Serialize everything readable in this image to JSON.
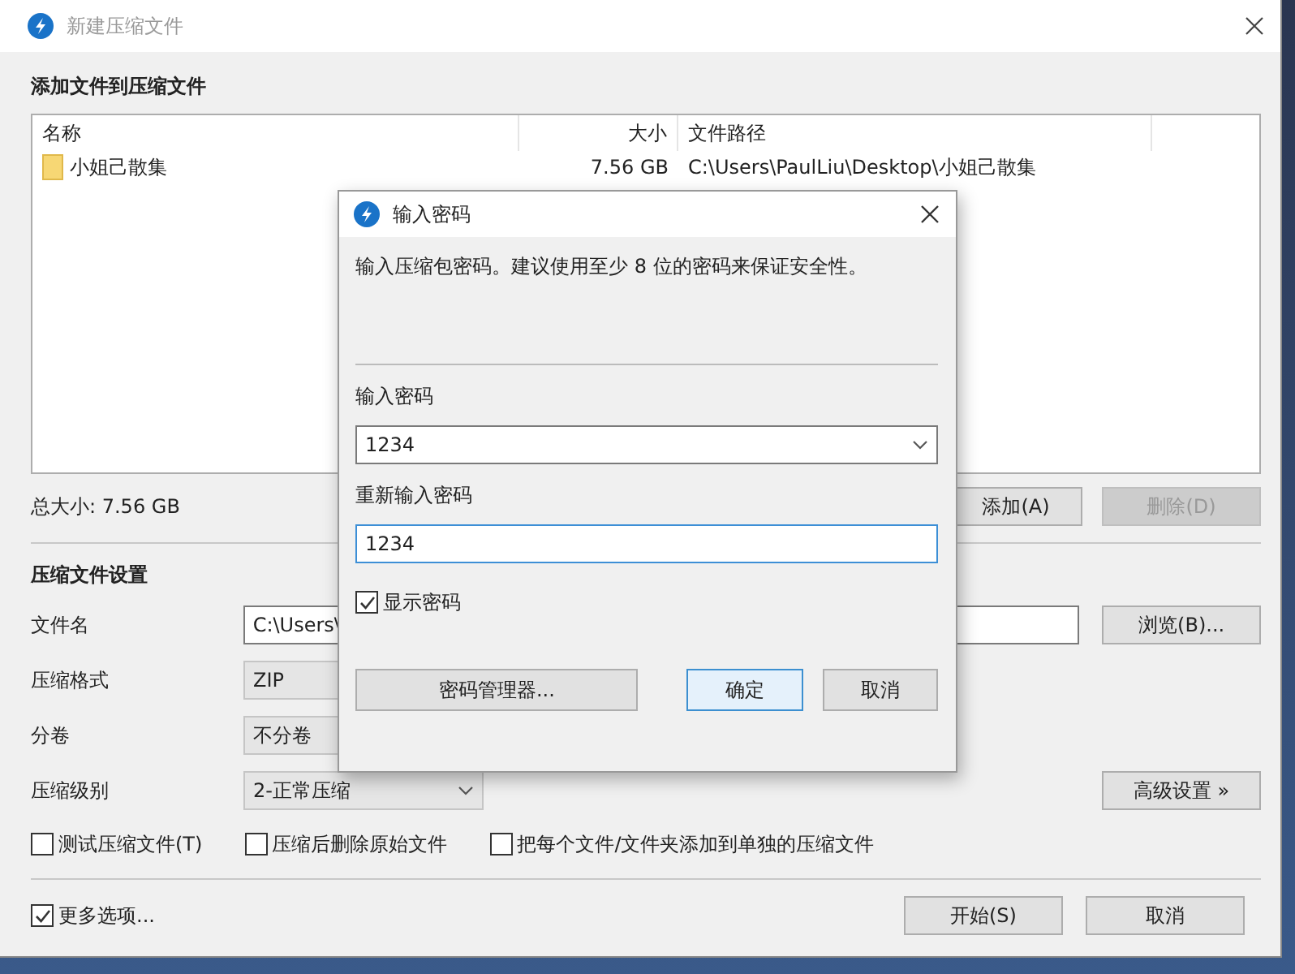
{
  "window": {
    "title": "新建压缩文件"
  },
  "files_section": {
    "heading": "添加文件到压缩文件",
    "columns": [
      "名称",
      "大小",
      "文件路径"
    ],
    "rows": [
      {
        "name": "小姐己散集",
        "size": "7.56 GB",
        "path": "C:\\Users\\PaulLiu\\Desktop\\小姐己散集"
      }
    ],
    "total": "总大小: 7.56 GB",
    "buttons": [
      {
        "label": "添加(A)",
        "disabled": false
      },
      {
        "label": "删除(D)",
        "disabled": true
      }
    ]
  },
  "settings": {
    "heading": "压缩文件设置",
    "rows": [
      {
        "kind": "field",
        "label": "文件名",
        "value": "C:\\Users\\",
        "button": "浏览(B)..."
      },
      {
        "kind": "select",
        "label": "压缩格式",
        "value": "ZIP"
      },
      {
        "kind": "select",
        "label": "分卷",
        "value": "不分卷"
      },
      {
        "kind": "select",
        "label": "压缩级别",
        "value": "2-正常压缩",
        "button": "高级设置 »"
      }
    ],
    "options": [
      {
        "label": "测试压缩文件(T)",
        "checked": false
      },
      {
        "label": "压缩后删除原始文件",
        "checked": false
      },
      {
        "label": "把每个文件/文件夹添加到单独的压缩文件",
        "checked": false
      }
    ]
  },
  "more_options": {
    "label": "更多选项...",
    "checked": true
  },
  "buttons": [
    "开始(S)",
    "取消"
  ],
  "dialog": {
    "title": "输入密码",
    "message": "输入压缩包密码。建议使用至少 8 位的密码来保证安全性。",
    "fields": [
      {
        "kind": "combo",
        "label": "输入密码",
        "value": "1234",
        "focused": false
      },
      {
        "kind": "text",
        "label": "重新输入密码",
        "value": "1234",
        "focused": true
      }
    ],
    "show_password": {
      "label": "显示密码",
      "checked": true
    },
    "buttons": [
      {
        "label": "密码管理器...",
        "default": false
      },
      {
        "label": "确定",
        "default": true
      },
      {
        "label": "取消",
        "default": false
      }
    ]
  }
}
